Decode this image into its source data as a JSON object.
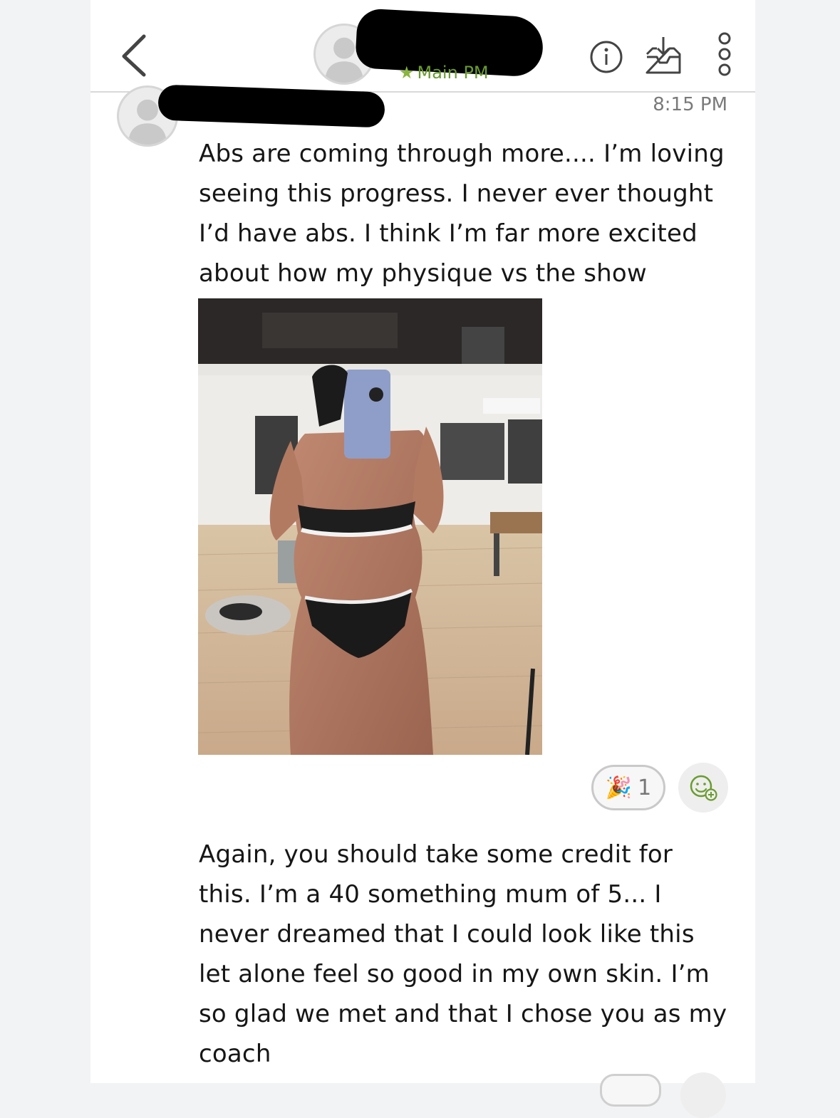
{
  "header": {
    "subtitle": "Main PM",
    "icons": [
      "back-chevron-icon",
      "info-icon",
      "inbox-download-icon",
      "more-vertical-icon"
    ]
  },
  "message": {
    "time": "8:15 PM",
    "text": "Abs are coming through more.... I’m loving\nseeing this progress. I never ever thought\nI’d have abs. I think I’m far more excited\nabout how my physique vs the show",
    "reaction": {
      "emoji": "🎉",
      "count": "1"
    }
  },
  "message2": {
    "text": "Again, you should take some credit for\nthis. I’m a 40 something mum of 5... I\nnever dreamed that I could look like this\nlet alone feel so good in my own skin. I’m\nso glad we met and that I chose you as my\ncoach"
  },
  "colors": {
    "accent": "#6a9c2e",
    "timestamp": "#7a7a7a",
    "divider": "#d9d9d9"
  }
}
